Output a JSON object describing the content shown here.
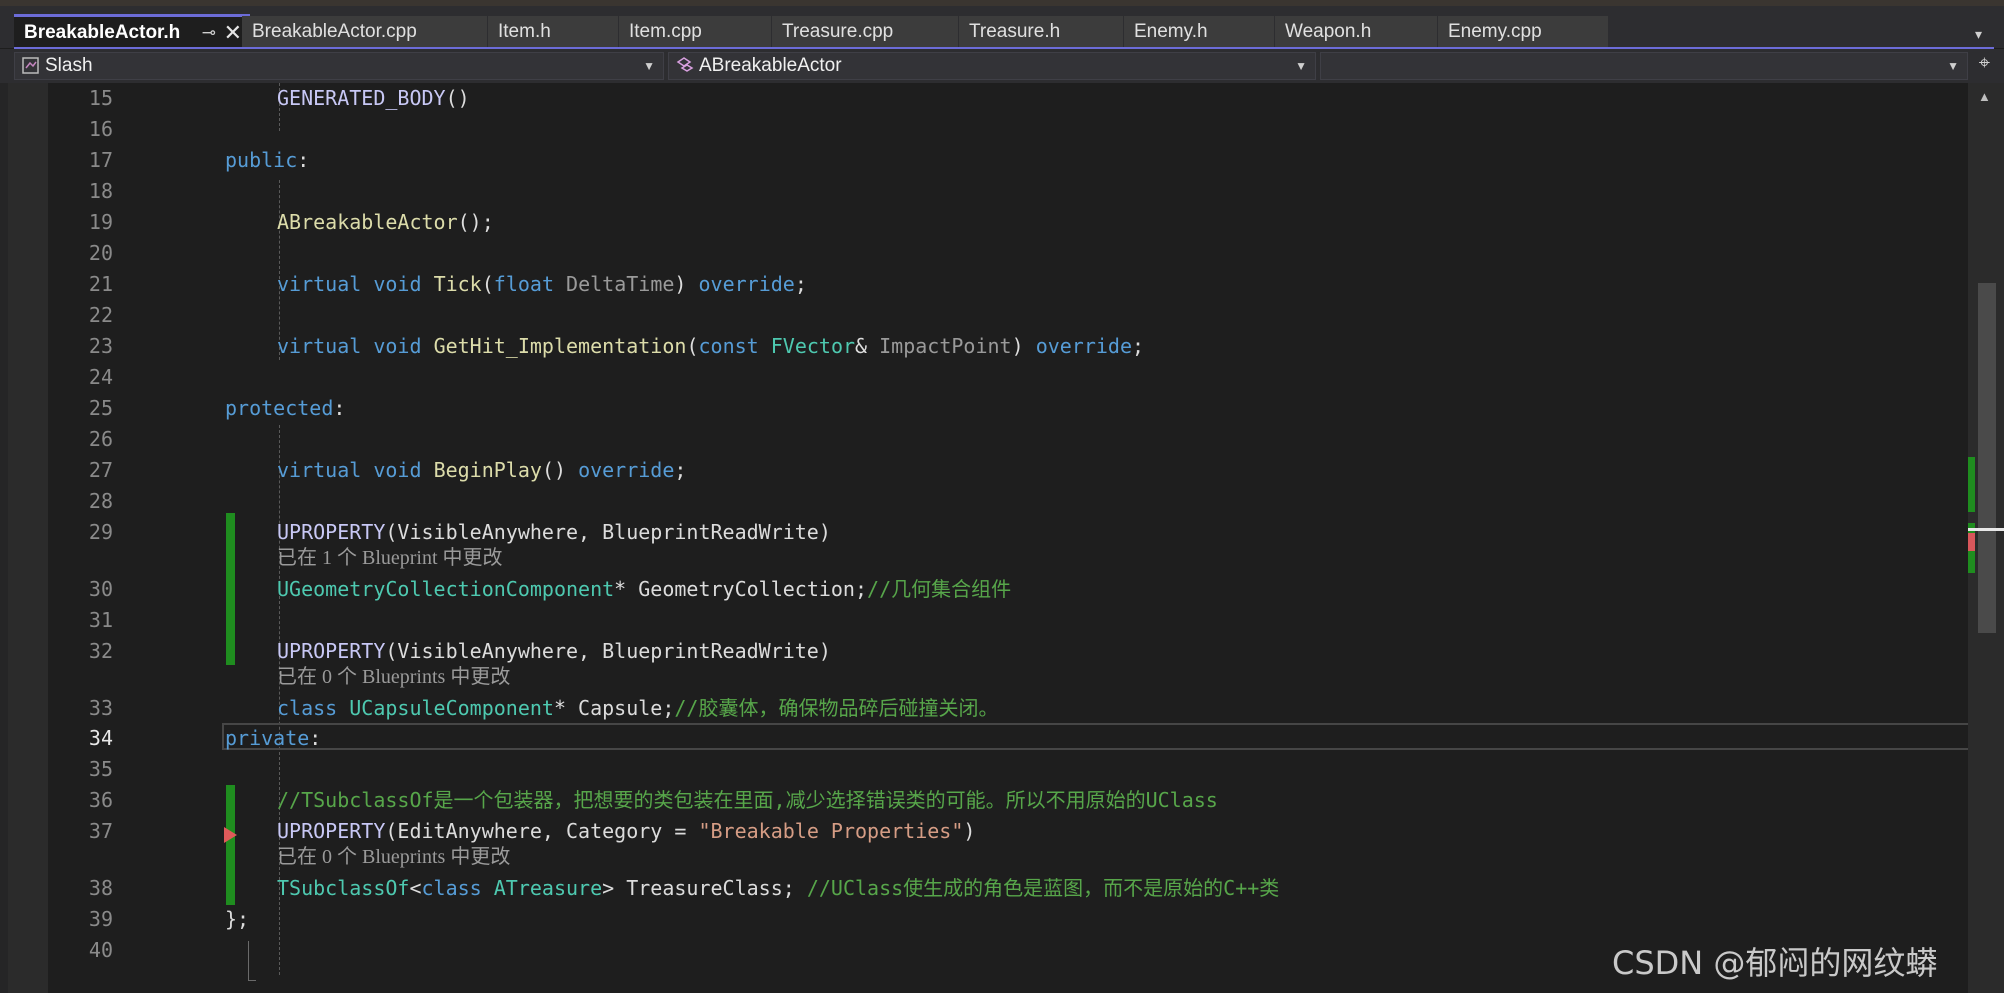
{
  "tabs": [
    {
      "label": "BreakableActor.h",
      "active": true
    },
    {
      "label": "BreakableActor.cpp"
    },
    {
      "label": "Item.h"
    },
    {
      "label": "Item.cpp"
    },
    {
      "label": "Treasure.cpp"
    },
    {
      "label": "Treasure.h"
    },
    {
      "label": "Enemy.h"
    },
    {
      "label": "Weapon.h"
    },
    {
      "label": "Enemy.cpp"
    }
  ],
  "tab_pin_glyph": "⊸",
  "tab_close_glyph": "✕",
  "tab_overflow_glyph": "▾",
  "navbar": {
    "project": "Slash",
    "scope": "ABreakableActor",
    "member": "",
    "split_glyph": "⌖"
  },
  "code": {
    "l15_ln": "15",
    "l15_t1": "GENERATED_BODY",
    "l15_t2": "()",
    "l16_ln": "16",
    "l17_ln": "17",
    "l17_t1": "public",
    "l17_t2": ":",
    "l18_ln": "18",
    "l19_ln": "19",
    "l19_t1": "ABreakableActor",
    "l19_t2": "();",
    "l20_ln": "20",
    "l21_ln": "21",
    "l21_t1": "virtual",
    "l21_t2": " ",
    "l21_t3": "void",
    "l21_t4": " ",
    "l21_t5": "Tick",
    "l21_t6": "(",
    "l21_t7": "float",
    "l21_t8": " ",
    "l21_t9": "DeltaTime",
    "l21_t10": ") ",
    "l21_t11": "override",
    "l21_t12": ";",
    "l22_ln": "22",
    "l23_ln": "23",
    "l23_t1": "virtual",
    "l23_t2": " ",
    "l23_t3": "void",
    "l23_t4": " ",
    "l23_t5": "GetHit_Implementation",
    "l23_t6": "(",
    "l23_t7": "const",
    "l23_t8": " ",
    "l23_t9": "FVector",
    "l23_t10": "& ",
    "l23_t11": "ImpactPoint",
    "l23_t12": ") ",
    "l23_t13": "override",
    "l23_t14": ";",
    "l24_ln": "24",
    "l25_ln": "25",
    "l25_t1": "protected",
    "l25_t2": ":",
    "l26_ln": "26",
    "l27_ln": "27",
    "l27_t1": "virtual",
    "l27_t2": " ",
    "l27_t3": "void",
    "l27_t4": " ",
    "l27_t5": "BeginPlay",
    "l27_t6": "() ",
    "l27_t7": "override",
    "l27_t8": ";",
    "l28_ln": "28",
    "l29_ln": "29",
    "l29_t1": "UPROPERTY",
    "l29_t2": "(VisibleAnywhere, BlueprintReadWrite)",
    "l29_hint": "已在 1 个 Blueprint 中更改",
    "l30_ln": "30",
    "l30_t1": "UGeometryCollectionComponent",
    "l30_t2": "* GeometryCollection;",
    "l30_t3": "//几何集合组件",
    "l31_ln": "31",
    "l32_ln": "32",
    "l32_t1": "UPROPERTY",
    "l32_t2": "(VisibleAnywhere, BlueprintReadWrite)",
    "l32_hint": "已在 0 个 Blueprints 中更改",
    "l33_ln": "33",
    "l33_t1": "class",
    "l33_t2": " ",
    "l33_t3": "UCapsuleComponent",
    "l33_t4": "* Capsule;",
    "l33_t5": "//胶囊体，确保物品碎后碰撞关闭。",
    "l34_ln": "34",
    "l34_t1": "private",
    "l34_t2": ":",
    "l35_ln": "35",
    "l36_ln": "36",
    "l36_t1": "//TSubclassOf是一个包装器，把想要的类包装在里面,减少选择错误类的可能。所以不用原始的UClass",
    "l37_ln": "37",
    "l37_t1": "UPROPERTY",
    "l37_t2": "(EditAnywhere, Category = ",
    "l37_t3": "\"Breakable Properties\"",
    "l37_t4": ")",
    "l37_hint": "已在 0 个 Blueprints 中更改",
    "l38_ln": "38",
    "l38_t1": "TSubclassOf",
    "l38_t2": "<",
    "l38_t3": "class",
    "l38_t4": " ",
    "l38_t5": "ATreasure",
    "l38_t6": "> TreasureClass; ",
    "l38_t7": "//UClass使生成的角色是蓝图，而不是原始的C++类",
    "l39_ln": "39",
    "l39_t1": "};",
    "l40_ln": "40"
  },
  "colors": {
    "accent": "#6c6cd8",
    "keyword": "#569cd6",
    "type": "#4ec9b0",
    "function": "#dcdcaa",
    "comment": "#57a64a",
    "string": "#d69d85",
    "change_marker": "#1f8d1f"
  },
  "scrollbar": {
    "up_glyph": "▲"
  },
  "watermark": "CSDN @郁闷的网纹蟒"
}
